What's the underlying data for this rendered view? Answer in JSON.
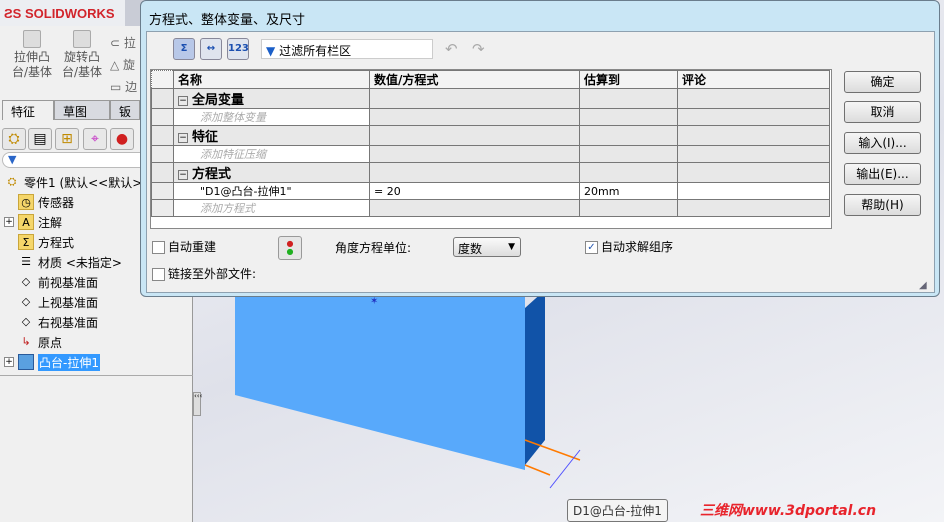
{
  "app": {
    "logo": "SOLIDWORKS"
  },
  "commands": [
    {
      "label": "拉伸凸\n台/基体"
    },
    {
      "label": "旋转凸\n台/基体"
    }
  ],
  "side_cmds": [
    "拉",
    "旋",
    "边"
  ],
  "tabs": [
    "特征",
    "草图",
    "钣"
  ],
  "tree": {
    "root": "零件1 (默认<<默认>...",
    "items": [
      "传感器",
      "注解",
      "方程式",
      "材质 <未指定>",
      "前视基准面",
      "上视基准面",
      "右视基准面",
      "原点",
      "凸台-拉伸1"
    ]
  },
  "dialog": {
    "title": "方程式、整体变量、及尺寸",
    "filter": "过滤所有栏区",
    "toolbar_icons": [
      "Σ",
      "↔",
      "123"
    ],
    "columns": [
      "名称",
      "数值/方程式",
      "估算到",
      "评论"
    ],
    "groups": [
      {
        "name": "全局变量",
        "add": "添加整体变量",
        "rows": []
      },
      {
        "name": "特征",
        "add": "添加特征压缩",
        "rows": []
      },
      {
        "name": "方程式",
        "add": "添加方程式",
        "rows": [
          {
            "name": "\"D1@凸台-拉伸1\"",
            "value": "= 20",
            "eval": "20mm",
            "comment": ""
          }
        ]
      }
    ],
    "buttons": [
      "确定",
      "取消",
      "输入(I)...",
      "输出(E)...",
      "帮助(H)"
    ],
    "auto_rebuild": "自动重建",
    "link_external": "链接至外部文件:",
    "angle_units_label": "角度方程单位:",
    "angle_units_value": "度数",
    "auto_solve": "自动求解组序",
    "auto_solve_checked": true
  },
  "tooltip": "D1@凸台-拉伸1",
  "watermark": "三维网www.3dportal.cn"
}
